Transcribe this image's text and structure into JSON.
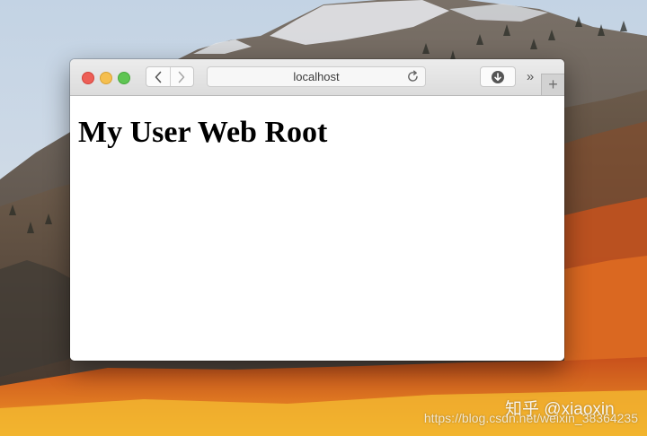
{
  "wallpaper": {
    "name": "macOS High Sierra",
    "colors": {
      "sky": "#cdd9e6",
      "rock": "#5e5248",
      "snow": "#e6e8ec",
      "foliage_orange": "#d9631d",
      "foliage_yellow": "#e9a224"
    }
  },
  "browser": {
    "address": "localhost",
    "controls": {
      "back_icon": "chevron-left-icon",
      "forward_icon": "chevron-right-icon",
      "reload_icon": "reload-icon",
      "download_icon": "download-icon",
      "more_label": "»",
      "new_tab_label": "+"
    }
  },
  "page": {
    "heading": "My User Web Root"
  },
  "watermark": {
    "brand": "知乎 @xiaoxin",
    "url": "https://blog.csdn.net/weixin_38364235"
  }
}
